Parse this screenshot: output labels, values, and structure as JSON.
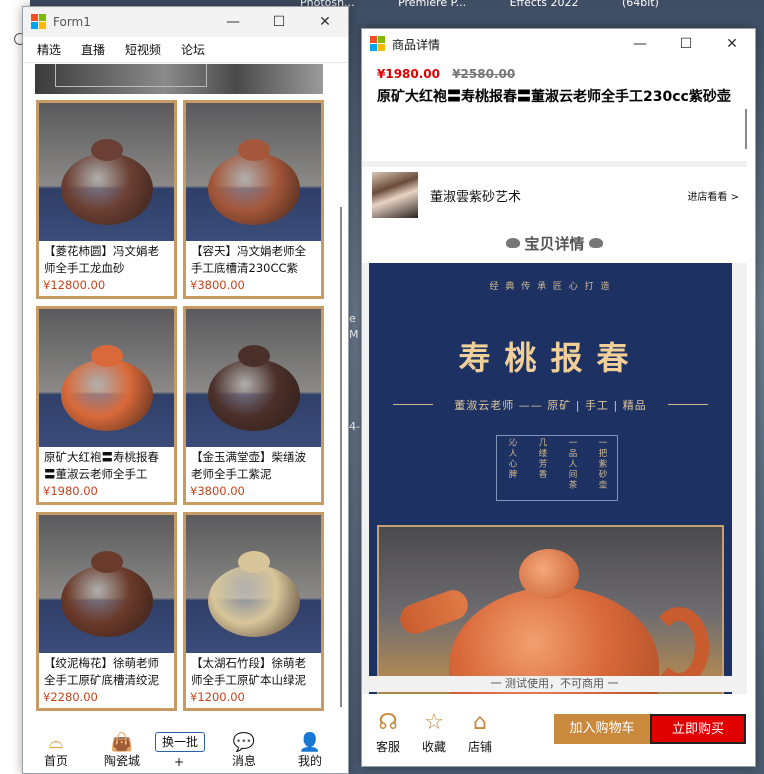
{
  "desktop": {
    "top_labels": [
      "Photosh...",
      "Premiere P...",
      "Effects 2022",
      "(64bit)"
    ],
    "side_fragments": [
      "e",
      "M",
      "4-"
    ]
  },
  "form1": {
    "title": "Form1",
    "controls": {
      "minimize": "—",
      "maximize": "☐",
      "close": "✕"
    },
    "menu": [
      "精选",
      "直播",
      "短视频",
      "论坛"
    ],
    "products": [
      {
        "name": "【菱花柿圆】冯文娟老师全手工龙血砂",
        "price": "¥12800.00",
        "color": "#6b3f33"
      },
      {
        "name": "【容天】冯文娟老师全手工底槽清230CC紫",
        "price": "¥3800.00",
        "color": "#a4573a"
      },
      {
        "name": "原矿大红袍〓寿桃报春〓董淑云老师全手工",
        "price": "¥1980.00",
        "color": "#d9693a"
      },
      {
        "name": "【金玉满堂壶】柴缮波老师全手工紫泥",
        "price": "¥3800.00",
        "color": "#4b2f2a"
      },
      {
        "name": "【绞泥梅花】徐萌老师全手工原矿底槽清绞泥",
        "price": "¥2280.00",
        "color": "#6a3a2a"
      },
      {
        "name": "【太湖石竹段】徐萌老师全手工原矿本山绿泥",
        "price": "¥1200.00",
        "color": "#d8c69a"
      }
    ],
    "nav": [
      {
        "label": "首页",
        "icon": "home-icon",
        "glyph": "⌓"
      },
      {
        "label": "陶瓷城",
        "icon": "shopping-bag-icon",
        "glyph": "👜"
      },
      {
        "label": "消息",
        "icon": "chat-icon",
        "glyph": "💬"
      },
      {
        "label": "我的",
        "icon": "user-icon",
        "glyph": "👤"
      }
    ],
    "refresh_button": "换一批",
    "plus_label": "+"
  },
  "detail": {
    "title": "商品详情",
    "price_now": "¥1980.00",
    "price_old": "¥2580.00",
    "product_title": "原矿大红袍〓寿桃报春〓董淑云老师全手工230cc紫砂壶",
    "shop_name": "董淑雲紫砂艺术",
    "shop_link": "进店看看 >",
    "section_title": "宝贝详情",
    "poster": {
      "motto": "经 典 传 承 匠 心 打 造",
      "headline": "寿桃报春",
      "sub": "董淑云老师 —— 原矿 | 手工 | 精品",
      "verses": [
        "一把紫砂壶",
        "一品人间茶",
        "几缕芳香",
        "沁人心脾"
      ]
    },
    "footer_note": "一  测试使用，不可商用  一",
    "actions": [
      {
        "label": "客服",
        "icon": "headset-icon",
        "glyph": "☊"
      },
      {
        "label": "收藏",
        "icon": "star-icon",
        "glyph": "☆"
      },
      {
        "label": "店铺",
        "icon": "store-icon",
        "glyph": "⌂"
      }
    ],
    "add_to_cart": "加入购物车",
    "buy_now": "立即购买",
    "colors": {
      "accent": "#c98a3e",
      "buy": "#e10000",
      "price": "#e00000",
      "poster_bg": "#1d3162"
    }
  }
}
